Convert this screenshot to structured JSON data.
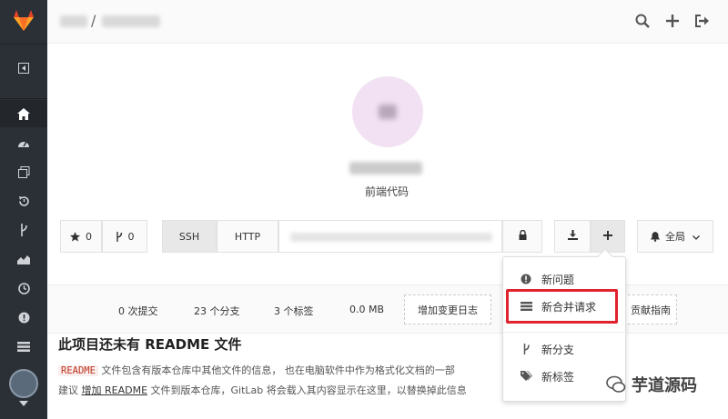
{
  "topbar": {
    "breadcrumb_sep": "/",
    "icons": [
      "search-icon",
      "plus-icon",
      "sign-out-icon"
    ]
  },
  "sidebar": {
    "items": [
      "collapse-icon",
      "home-icon",
      "dashboard-icon",
      "files-icon",
      "history-icon",
      "branch-icon",
      "graph-icon",
      "clock-icon",
      "issues-icon",
      "merge-icon",
      "settings-icon"
    ]
  },
  "project": {
    "description": "前端代码"
  },
  "controls": {
    "star_count": "0",
    "fork_count": "0",
    "ssh_label": "SSH",
    "http_label": "HTTP",
    "notify_label": "全局"
  },
  "stats": {
    "commits": "0 次提交",
    "branches": "23 个分支",
    "tags": "3 个标签",
    "size": "0.0 MB",
    "changelog_button": "增加变更日志",
    "contrib_button": "贡献指南"
  },
  "readme": {
    "title": "此项目还未有 README 文件",
    "code": "README",
    "line1_text": " 文件包含有版本仓库中其他文件的信息， 也在电脑软件中作为格式化文档的一部",
    "line2_prefix": "建议 ",
    "line2_link": "增加 README",
    "line2_text": " 文件到版本仓库，GitLab 将会载入其内容显示在这里，以替换掉此信息"
  },
  "dropdown": {
    "new_issue": "新问题",
    "new_merge_request": "新合并请求",
    "new_branch": "新分支",
    "new_tag": "新标签"
  },
  "watermark": {
    "text": "芋道源码"
  },
  "colors": {
    "sidebar_bg": "#2b3036",
    "highlight": "#e0232d",
    "avatar_bg": "#f2e1f3"
  }
}
